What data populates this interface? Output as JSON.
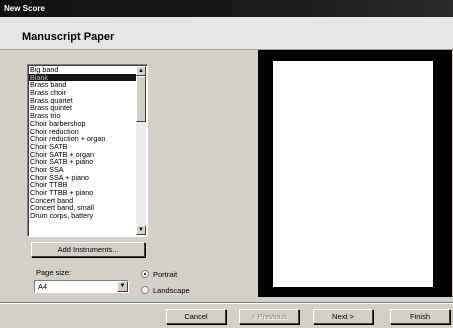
{
  "window": {
    "title": "New Score"
  },
  "header": {
    "title": "Manuscript Paper"
  },
  "paper_list": {
    "items": [
      "Big band",
      "Blank",
      "Brass band",
      "Brass choir",
      "Brass quartet",
      "Brass quintet",
      "Brass trio",
      "Choir barbershop",
      "Choir reduction",
      "Choir reduction + organ",
      "Choir SATB",
      "Choir SATB + organ",
      "Choir SATB + piano",
      "Choir SSA",
      "Choir SSA + piano",
      "Choir TTBB",
      "Choir TTBB + piano",
      "Concert band",
      "Concert band, small",
      "Drum corps, battery"
    ],
    "selected": "Blank"
  },
  "buttons": {
    "add_instruments": "Add Instruments...",
    "cancel": "Cancel",
    "previous": "< Previous",
    "next": "Next >",
    "finish": "Finish"
  },
  "page_size": {
    "label": "Page size:",
    "value": "A4"
  },
  "orientation": {
    "portrait": "Portrait",
    "landscape": "Landscape",
    "selected": "Portrait"
  }
}
